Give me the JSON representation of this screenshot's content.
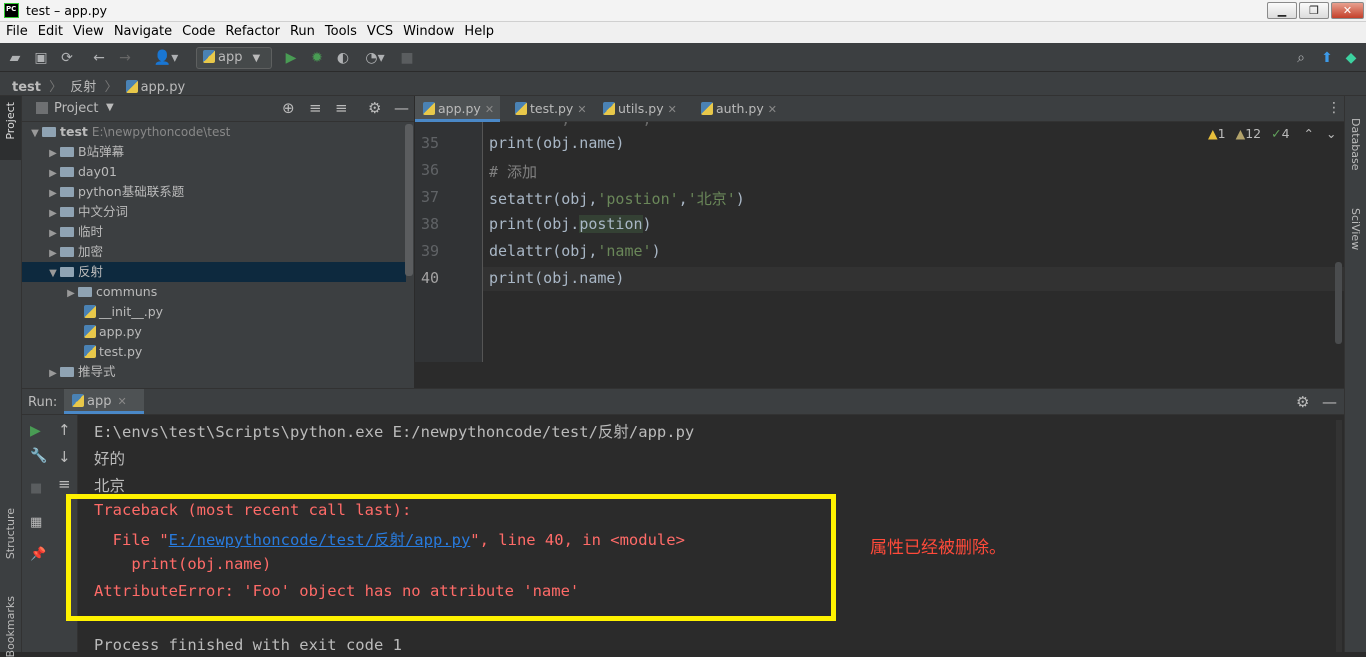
{
  "window": {
    "title": "test – app.py",
    "buttons": [
      "▁",
      "❐",
      "✕"
    ]
  },
  "menu": [
    "File",
    "Edit",
    "View",
    "Navigate",
    "Code",
    "Refactor",
    "Run",
    "Tools",
    "VCS",
    "Window",
    "Help"
  ],
  "toolbar": {
    "run_config": "app"
  },
  "breadcrumb": [
    "test",
    "反射",
    "app.py"
  ],
  "left_stripe": {
    "project": "Project",
    "structure": "Structure",
    "bookmarks": "Bookmarks"
  },
  "right_stripe": {
    "database": "Database",
    "sciview": "SciView"
  },
  "project": {
    "header": "Project",
    "root_name": "test",
    "root_path": "E:\\newpythoncode\\test",
    "items": [
      {
        "label": "B站弹幕"
      },
      {
        "label": "day01"
      },
      {
        "label": "python基础联系题"
      },
      {
        "label": "中文分词"
      },
      {
        "label": "临时"
      },
      {
        "label": "加密"
      },
      {
        "label": "反射"
      },
      {
        "label": "communs"
      },
      {
        "label": "__init__.py"
      },
      {
        "label": "app.py"
      },
      {
        "label": "test.py"
      },
      {
        "label": "推导式"
      }
    ]
  },
  "editor": {
    "tabs": [
      {
        "label": "app.py"
      },
      {
        "label": "test.py"
      },
      {
        "label": "utils.py"
      },
      {
        "label": "auth.py"
      }
    ],
    "inspections": {
      "errors": "1",
      "warnings": "12",
      "ok": "4"
    },
    "lines": [
      {
        "num": "35",
        "p1": "print(obj.name)"
      },
      {
        "num": "36",
        "p1": "# 添加"
      },
      {
        "num": "37",
        "p1": "setattr(obj,",
        "p2": "'postion'",
        "p3": ",",
        "p4": "'北京'",
        "p5": ")"
      },
      {
        "num": "38",
        "p1": "print(obj.",
        "p2": "postion",
        "p3": ")"
      },
      {
        "num": "39",
        "p1": "delattr(obj,",
        "p2": "'name'",
        "p3": ")"
      },
      {
        "num": "40",
        "p1": "print(obj.name)"
      }
    ]
  },
  "run": {
    "label": "Run:",
    "tab": "app",
    "output": {
      "cmd": "E:\\envs\\test\\Scripts\\python.exe E:/newpythoncode/test/反射/app.py",
      "out1": "好的",
      "out2": "北京",
      "tb_head": "Traceback (most recent call last):",
      "tb_file_pre": "  File \"",
      "tb_file_link": "E:/newpythoncode/test/反射/app.py",
      "tb_file_post": "\", line 40, in <module>",
      "tb_code": "    print(obj.name)",
      "tb_error": "AttributeError: 'Foo' object has no attribute 'name'",
      "exit": "Process finished with exit code 1"
    }
  },
  "annotation": "属性已经被删除。"
}
